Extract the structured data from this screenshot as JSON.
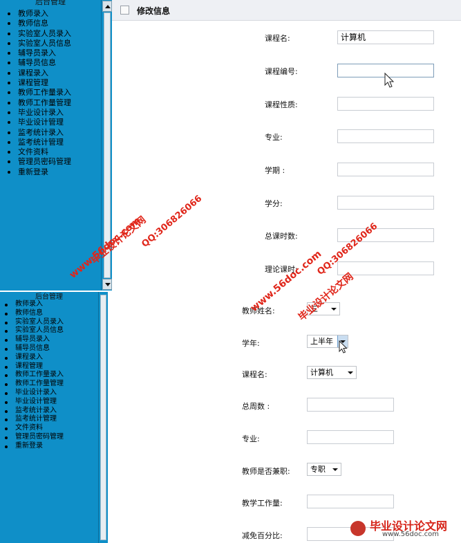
{
  "top_panel": {
    "sidebar": {
      "title": "后台管理",
      "items": [
        "教师录入",
        "教师信息",
        "实验室人员录入",
        "实验室人员信息",
        "辅导员录入",
        "辅导员信息",
        "课程录入",
        "课程管理",
        "教师工作量录入",
        "教师工作量管理",
        "毕业设计录入",
        "毕业设计管理",
        "监考统计录入",
        "监考统计管理",
        "文件资料",
        "管理员密码管理",
        "重新登录"
      ]
    },
    "header": {
      "title": "修改信息"
    },
    "fields": [
      {
        "label": "课程名:",
        "value": "计算机"
      },
      {
        "label": "课程编号:",
        "value": ""
      },
      {
        "label": "课程性质:",
        "value": ""
      },
      {
        "label": "专业:",
        "value": ""
      },
      {
        "label": "学期 :",
        "value": ""
      },
      {
        "label": "学分:",
        "value": ""
      },
      {
        "label": "总课时数:",
        "value": ""
      },
      {
        "label": "理论课时:",
        "value": ""
      }
    ]
  },
  "bottom_panel": {
    "sidebar": {
      "title": "后台管理",
      "items": [
        "教师录入",
        "教师信息",
        "实验室人员录入",
        "实验室人员信息",
        "辅导员录入",
        "辅导员信息",
        "课程录入",
        "课程管理",
        "教师工作量录入",
        "教师工作量管理",
        "毕业设计录入",
        "毕业设计管理",
        "监考统计录入",
        "监考统计管理",
        "文件资料",
        "管理员密码管理",
        "重新登录"
      ]
    },
    "fields": [
      {
        "label": "教师姓名:",
        "value": "三",
        "kind": "select"
      },
      {
        "label": "学年:",
        "value": "上半年",
        "kind": "select"
      },
      {
        "label": "课程名:",
        "value": "计算机",
        "kind": "select"
      },
      {
        "label": "总周数 :",
        "value": "",
        "kind": "input"
      },
      {
        "label": "专业:",
        "value": "",
        "kind": "input"
      },
      {
        "label": "教师是否兼职:",
        "value": "专职",
        "kind": "select"
      },
      {
        "label": "教学工作量:",
        "value": "",
        "kind": "input"
      },
      {
        "label": "减免百分比:",
        "value": "",
        "kind": "input"
      }
    ]
  },
  "watermarks": {
    "site_name": "毕业设计论文网",
    "url": "www.56doc.com",
    "qq": "QQ:306826066",
    "brand_url": "www.56doc.com"
  },
  "colors": {
    "sidebar": "#0f8fc8",
    "watermark": "#e0261a",
    "header_bg": "#eef0f4"
  },
  "icons": {
    "cursor": "mouse-pointer-icon",
    "dropdown": "chevron-down-icon",
    "scroll_up": "scroll-up-icon",
    "scroll_down": "scroll-down-icon"
  }
}
